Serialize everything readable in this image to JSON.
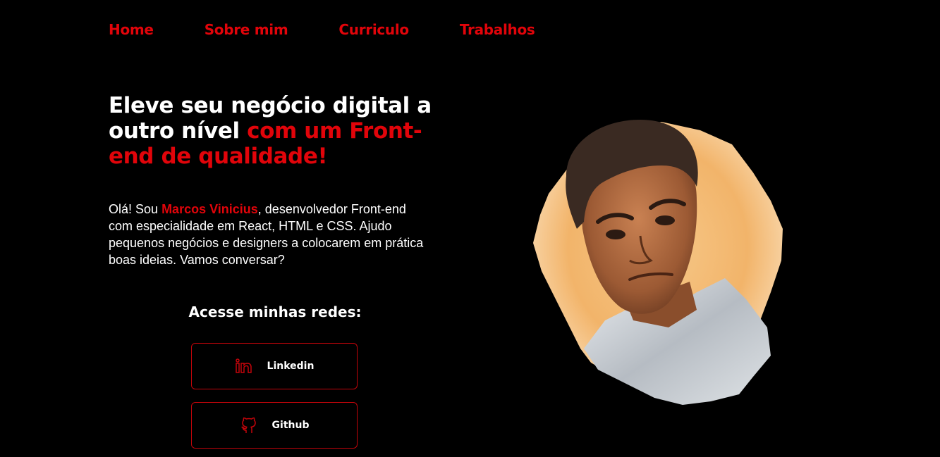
{
  "nav": {
    "items": [
      {
        "label": "Home"
      },
      {
        "label": "Sobre mim"
      },
      {
        "label": "Curriculo"
      },
      {
        "label": "Trabalhos"
      }
    ]
  },
  "hero": {
    "headline_white": "Eleve seu negócio digital a outro nível",
    "headline_red": "com um Front-end de qualidade!",
    "intro_before_name": "Olá! Sou",
    "intro_name": "Marcos Vinicius",
    "intro_after_name": ", desenvolvedor Front-end com especialidade em React, HTML e CSS. Ajudo pequenos negócios e designers a colocarem em prática boas ideias. Vamos conversar?"
  },
  "social": {
    "title": "Acesse minhas redes:",
    "buttons": [
      {
        "label": "Linkedin",
        "icon": "linkedin-icon"
      },
      {
        "label": "Github",
        "icon": "github-icon"
      }
    ]
  },
  "colors": {
    "accent": "#e1040a",
    "background": "#000000",
    "text": "#ffffff"
  }
}
